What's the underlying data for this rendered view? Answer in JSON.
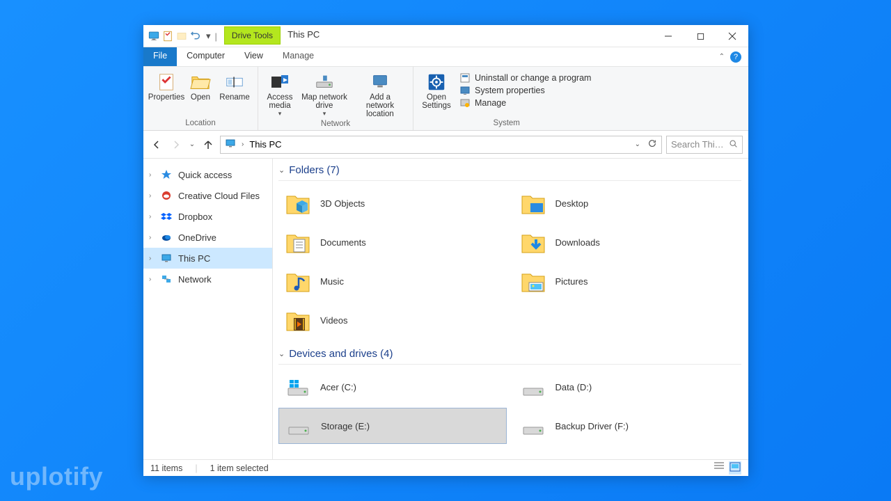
{
  "window": {
    "drive_tools": "Drive Tools",
    "title": "This PC"
  },
  "qat": {
    "dropdown_symbol": "▾"
  },
  "tabs": {
    "file": "File",
    "computer": "Computer",
    "view": "View",
    "manage": "Manage"
  },
  "ribbon": {
    "location": {
      "label": "Location",
      "properties": "Properties",
      "open": "Open",
      "rename": "Rename"
    },
    "network": {
      "label": "Network",
      "access_media": "Access media",
      "map_drive": "Map network drive",
      "add_location": "Add a network location"
    },
    "system": {
      "label": "System",
      "open_settings": "Open Settings",
      "uninstall": "Uninstall or change a program",
      "system_properties": "System properties",
      "manage": "Manage"
    }
  },
  "addressbar": {
    "path": "This PC"
  },
  "search": {
    "placeholder": "Search Thi…"
  },
  "sidebar": {
    "items": [
      {
        "label": "Quick access"
      },
      {
        "label": "Creative Cloud Files"
      },
      {
        "label": "Dropbox"
      },
      {
        "label": "OneDrive"
      },
      {
        "label": "This PC"
      },
      {
        "label": "Network"
      }
    ]
  },
  "groups": {
    "folders": {
      "header": "Folders (7)",
      "items": [
        {
          "label": "3D Objects"
        },
        {
          "label": "Desktop"
        },
        {
          "label": "Documents"
        },
        {
          "label": "Downloads"
        },
        {
          "label": "Music"
        },
        {
          "label": "Pictures"
        },
        {
          "label": "Videos"
        }
      ]
    },
    "drives": {
      "header": "Devices and drives (4)",
      "items": [
        {
          "label": "Acer (C:)"
        },
        {
          "label": "Data (D:)"
        },
        {
          "label": "Storage (E:)"
        },
        {
          "label": "Backup Driver (F:)"
        }
      ]
    }
  },
  "statusbar": {
    "item_count": "11 items",
    "selection": "1 item selected"
  },
  "watermark": "uplotify"
}
